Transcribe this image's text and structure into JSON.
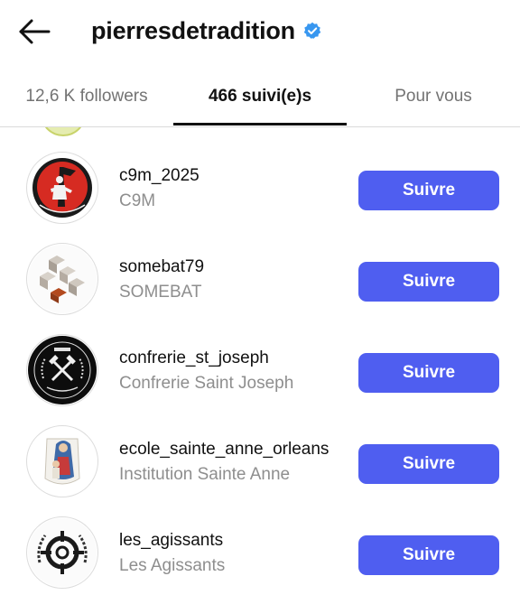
{
  "header": {
    "username": "pierresdetradition",
    "verified": true,
    "back_icon": "arrow-left-icon"
  },
  "tabs": [
    {
      "label": "12,6 K followers",
      "active": false
    },
    {
      "label": "466 suivi(e)s",
      "active": true
    },
    {
      "label": "Pour vous",
      "active": false
    }
  ],
  "accounts": [
    {
      "username": "c9m_2025",
      "name": "C9M",
      "button": "Suivre"
    },
    {
      "username": "somebat79",
      "name": "SOMEBAT",
      "button": "Suivre"
    },
    {
      "username": "confrerie_st_joseph",
      "name": "Confrerie Saint Joseph",
      "button": "Suivre"
    },
    {
      "username": "ecole_sainte_anne_orleans",
      "name": "Institution Sainte Anne",
      "button": "Suivre"
    },
    {
      "username": "les_agissants",
      "name": "Les Agissants",
      "button": "Suivre"
    }
  ],
  "colors": {
    "accent": "#4f5ef0",
    "verified_badge": "#3897f0"
  }
}
